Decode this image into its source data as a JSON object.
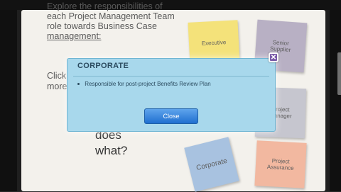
{
  "intro": {
    "line1": "Explore the responsibilities of",
    "line2": "each Project Management Team",
    "line3": "role towards Business Case",
    "line4": "management:"
  },
  "click": {
    "line1": "Click",
    "line2": "more"
  },
  "question": {
    "line1": "does",
    "line2": "what?"
  },
  "notes": {
    "executive": "Executive",
    "senior": "Senior\nSupplier",
    "project_manager": "Project\nManager",
    "corporate": "Corporate",
    "assurance": "Project\nAssurance"
  },
  "dialog": {
    "title": "CORPORATE",
    "bullet": "Responsible for post-project Benefits Review Plan",
    "close_label": "Close",
    "close_icon": "close-icon"
  }
}
